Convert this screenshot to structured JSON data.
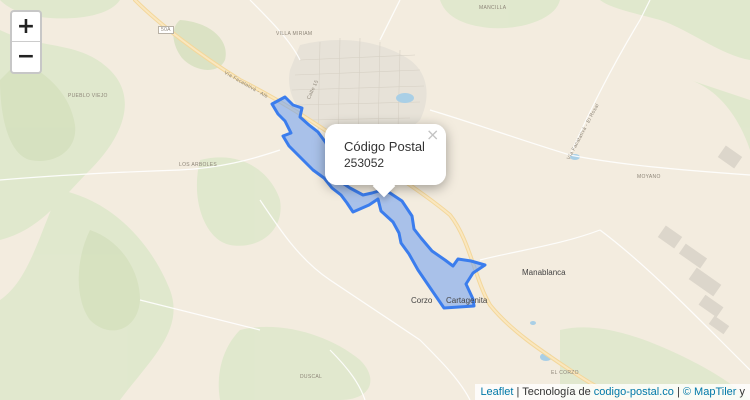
{
  "zoom": {
    "in_label": "+",
    "out_label": "−"
  },
  "popup": {
    "title": "Código Postal",
    "code": "253052",
    "close_label": "×"
  },
  "attribution": {
    "leaflet": "Leaflet",
    "sep1": " | Tecnología de ",
    "site": "codigo-postal.co",
    "sep2": " | ",
    "copyright": "© MapTiler",
    "tail": " y"
  },
  "map_labels": {
    "villa_miriam": "VILLA MIRIAM",
    "mancilla": "MANCILLA",
    "pueblo_viejo": "PUEBLO VIEJO",
    "los_arboles": "LOS ARBOLES",
    "moyano": "MOYANO",
    "duscal": "DUSCAL",
    "el_corzo": "EL CORZO",
    "road_50a": "50A",
    "calle_15": "Calle 15",
    "via_facatativa": "Vía Facatativá - Alb",
    "via_facatativa_el_rosal": "Vía Facatativá - El Rosal"
  },
  "towns": {
    "manablanca": "Manablanca",
    "corzo": "Corzo",
    "cartagenita": "Cartagenita"
  },
  "colors": {
    "polygon_fill": "#6b9ef0",
    "polygon_stroke": "#3b7ded",
    "link": "#0078a8"
  }
}
